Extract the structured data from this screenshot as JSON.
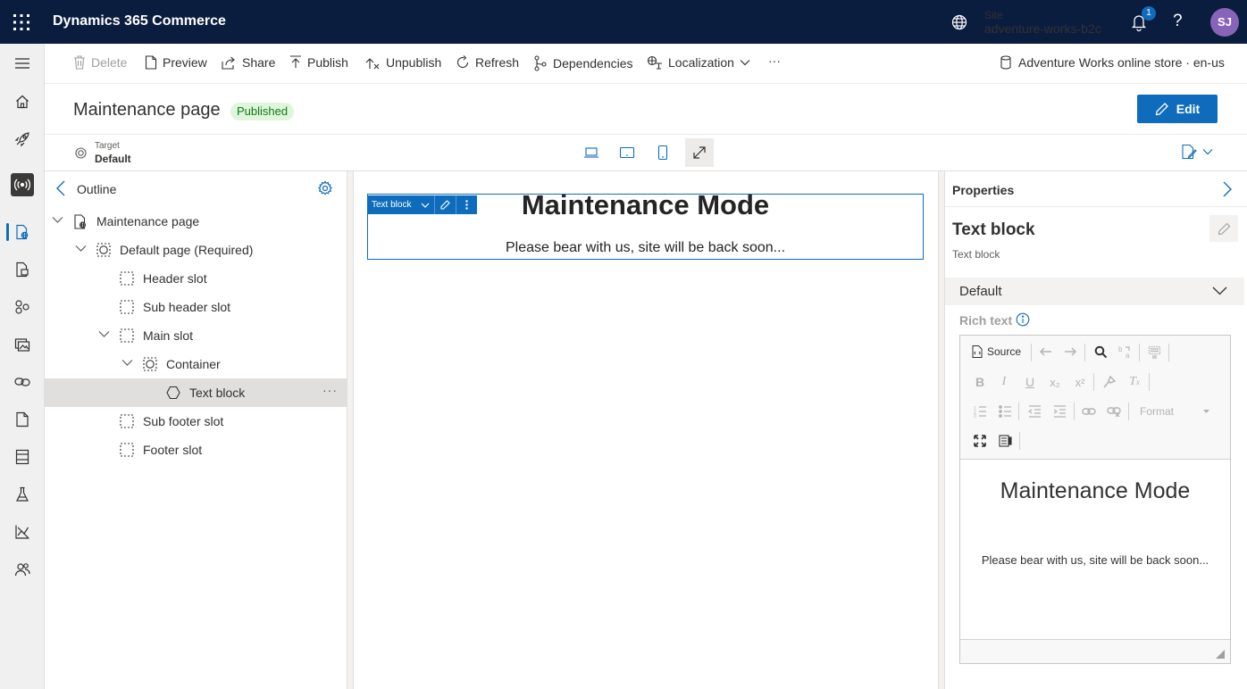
{
  "app": {
    "title": "Dynamics 365 Commerce",
    "site_label": "Site",
    "site_name": "adventure-works-b2c",
    "notification_count": "1",
    "help_label": "?",
    "user_initials": "SJ"
  },
  "commands": {
    "delete": "Delete",
    "preview": "Preview",
    "share": "Share",
    "publish": "Publish",
    "unpublish": "Unpublish",
    "refresh": "Refresh",
    "dependencies": "Dependencies",
    "localization": "Localization",
    "more": "···",
    "store": "Adventure Works online store · en-us"
  },
  "page": {
    "title": "Maintenance page",
    "status": "Published",
    "edit_label": "Edit"
  },
  "target": {
    "label": "Target",
    "value": "Default"
  },
  "outline": {
    "title": "Outline",
    "rows": [
      {
        "label": "Maintenance page"
      },
      {
        "label": "Default page (Required)"
      },
      {
        "label": "Header slot"
      },
      {
        "label": "Sub header slot"
      },
      {
        "label": "Main slot"
      },
      {
        "label": "Container"
      },
      {
        "label": "Text block"
      },
      {
        "label": "Sub footer slot"
      },
      {
        "label": "Footer slot"
      }
    ],
    "more": "···"
  },
  "canvas": {
    "module_label": "Text block",
    "heading": "Maintenance Mode",
    "body": "Please bear with us, site will be back soon..."
  },
  "properties": {
    "title": "Properties",
    "module_name": "Text block",
    "module_type": "Text block",
    "section": "Default",
    "rich_text_label": "Rich text",
    "source_label": "Source",
    "format_label": "Format",
    "editor_heading": "Maintenance Mode",
    "editor_body": "Please bear with us, site will be back soon..."
  },
  "colors": {
    "topbar": "#0b1d3f",
    "accent": "#0f6cbd",
    "published_bg": "#dff6dd",
    "published_text": "#107c10",
    "avatar": "#8764b8"
  }
}
